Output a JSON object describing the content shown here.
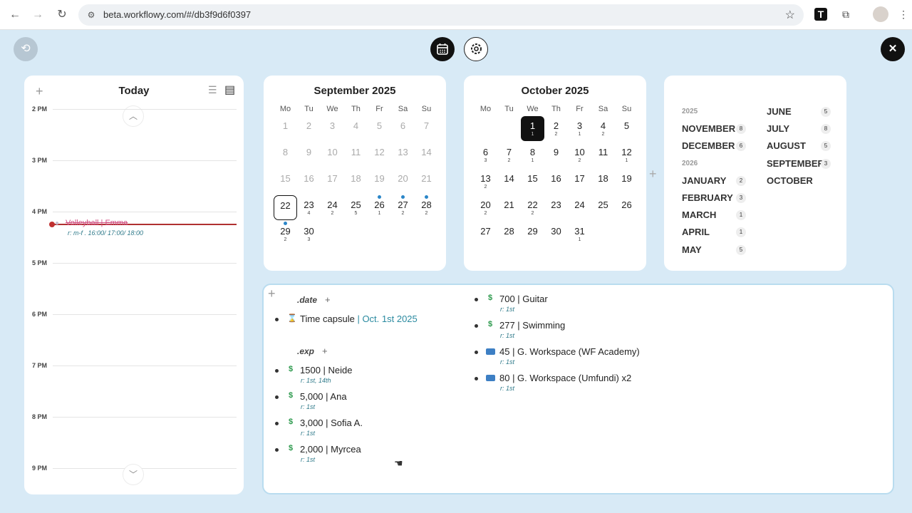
{
  "browser": {
    "url": "beta.workflowy.com/#/db3f9d6f0397",
    "back_icon": "back-arrow-icon",
    "forward_icon": "forward-arrow-icon",
    "reload_icon": "reload-icon",
    "ext_t": "T"
  },
  "day": {
    "title": "Today",
    "add": "+",
    "hours": [
      "2 PM",
      "3 PM",
      "4 PM",
      "5 PM",
      "6 PM",
      "7 PM",
      "8 PM",
      "9 PM"
    ],
    "event": {
      "title": "Volleyball | Emma",
      "tag": "r: m-f . 16:00/ 17:00/ 18:00"
    }
  },
  "weekdays": [
    "Mo",
    "Tu",
    "We",
    "Th",
    "Fr",
    "Sa",
    "Su"
  ],
  "september": {
    "title": "September 2025",
    "days": [
      {
        "d": "1",
        "muted": true
      },
      {
        "d": "2",
        "muted": true
      },
      {
        "d": "3",
        "muted": true
      },
      {
        "d": "4",
        "muted": true
      },
      {
        "d": "5",
        "muted": true
      },
      {
        "d": "6",
        "muted": true
      },
      {
        "d": "7",
        "muted": true
      },
      {
        "d": "8",
        "muted": true
      },
      {
        "d": "9",
        "muted": true
      },
      {
        "d": "10",
        "muted": true
      },
      {
        "d": "11",
        "muted": true
      },
      {
        "d": "12",
        "muted": true
      },
      {
        "d": "13",
        "muted": true
      },
      {
        "d": "14",
        "muted": true
      },
      {
        "d": "15",
        "muted": true
      },
      {
        "d": "16",
        "muted": true
      },
      {
        "d": "17",
        "muted": true
      },
      {
        "d": "18",
        "muted": true
      },
      {
        "d": "19",
        "muted": true
      },
      {
        "d": "20",
        "muted": true
      },
      {
        "d": "21",
        "muted": true
      },
      {
        "d": "22",
        "c": "",
        "today": true
      },
      {
        "d": "23",
        "c": "4"
      },
      {
        "d": "24",
        "c": "2"
      },
      {
        "d": "25",
        "c": "5"
      },
      {
        "d": "26",
        "c": "1",
        "dot": true
      },
      {
        "d": "27",
        "c": "2",
        "dot": true
      },
      {
        "d": "28",
        "c": "2",
        "dot": true
      },
      {
        "d": "29",
        "c": "2",
        "dot": true
      },
      {
        "d": "30",
        "c": "3"
      }
    ]
  },
  "october": {
    "title": "October 2025",
    "days": [
      null,
      null,
      {
        "d": "1",
        "c": "1",
        "selected": true
      },
      {
        "d": "2",
        "c": "2"
      },
      {
        "d": "3",
        "c": "1"
      },
      {
        "d": "4",
        "c": "2"
      },
      {
        "d": "5",
        "c": ""
      },
      {
        "d": "6",
        "c": "3"
      },
      {
        "d": "7",
        "c": "2"
      },
      {
        "d": "8",
        "c": "1"
      },
      {
        "d": "9",
        "c": ""
      },
      {
        "d": "10",
        "c": "2"
      },
      {
        "d": "11",
        "c": ""
      },
      {
        "d": "12",
        "c": "1"
      },
      {
        "d": "13",
        "c": "2"
      },
      {
        "d": "14",
        "c": ""
      },
      {
        "d": "15",
        "c": ""
      },
      {
        "d": "16",
        "c": ""
      },
      {
        "d": "17",
        "c": ""
      },
      {
        "d": "18",
        "c": ""
      },
      {
        "d": "19",
        "c": ""
      },
      {
        "d": "20",
        "c": "2"
      },
      {
        "d": "21",
        "c": ""
      },
      {
        "d": "22",
        "c": "2"
      },
      {
        "d": "23",
        "c": ""
      },
      {
        "d": "24",
        "c": ""
      },
      {
        "d": "25",
        "c": ""
      },
      {
        "d": "26",
        "c": ""
      },
      {
        "d": "27",
        "c": ""
      },
      {
        "d": "28",
        "c": ""
      },
      {
        "d": "29",
        "c": ""
      },
      {
        "d": "30",
        "c": ""
      },
      {
        "d": "31",
        "c": "1"
      }
    ]
  },
  "months": {
    "col1": [
      {
        "year": "2025"
      },
      {
        "name": "NOVEMBER",
        "count": "8"
      },
      {
        "name": "DECEMBER",
        "count": "6"
      },
      {
        "year": "2026"
      },
      {
        "name": "JANUARY",
        "count": "2"
      },
      {
        "name": "FEBRUARY",
        "count": "3"
      },
      {
        "name": "MARCH",
        "count": "1"
      },
      {
        "name": "APRIL",
        "count": "1"
      },
      {
        "name": "MAY",
        "count": "5"
      }
    ],
    "col2": [
      {
        "name": "JUNE",
        "count": "5"
      },
      {
        "name": "JULY",
        "count": "8"
      },
      {
        "name": "AUGUST",
        "count": "5"
      },
      {
        "name": "SEPTEMBER",
        "count": "3"
      },
      {
        "name": "OCTOBER",
        "count": ""
      }
    ]
  },
  "notes": {
    "date_section": ".date",
    "exp_section": ".exp",
    "time_capsule": {
      "label": "Time capsule",
      "sep": " | ",
      "date": "Oct. 1st 2025",
      "icon": "hourglass-icon"
    },
    "left_items": [
      {
        "text": "1500 | Neide",
        "tag": "r: 1st, 14th",
        "icon": "money-icon"
      },
      {
        "text": "5,000 | Ana",
        "tag": "r: 1st",
        "icon": "money-icon"
      },
      {
        "text": "3,000 | Sofia A.",
        "tag": "r: 1st",
        "icon": "money-icon"
      },
      {
        "text": "2,000 | Myrcea",
        "tag": "r: 1st",
        "icon": "money-icon"
      }
    ],
    "right_items": [
      {
        "text": "700 | Guitar",
        "tag": "r: 1st",
        "icon": "money-icon"
      },
      {
        "text": "277 | Swimming",
        "tag": "r: 1st",
        "icon": "money-icon"
      },
      {
        "text": "45 | G. Workspace (WF Academy)",
        "tag": "r: 1st",
        "icon": "credit-card-icon"
      },
      {
        "text": "80 | G. Workspace (Umfundi) x2",
        "tag": "r: 1st",
        "icon": "credit-card-icon"
      }
    ]
  }
}
